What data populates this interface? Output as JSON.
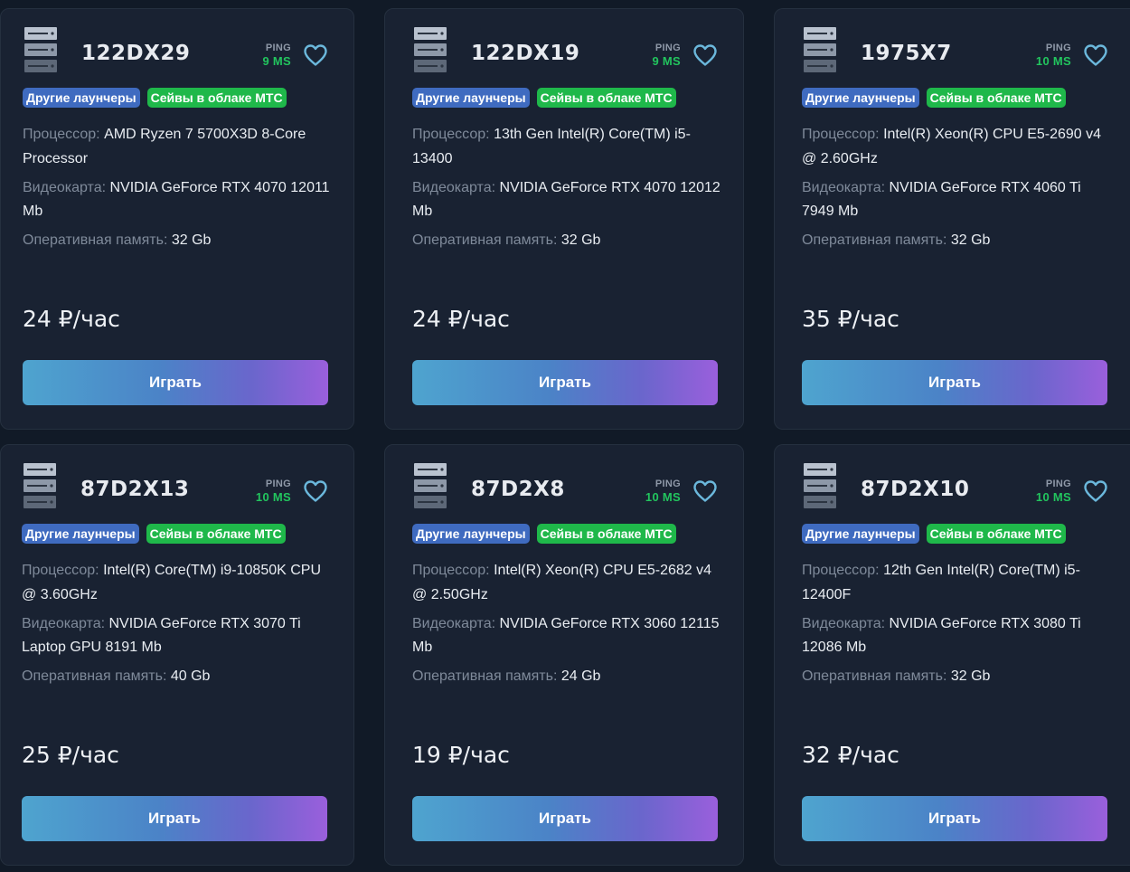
{
  "labels": {
    "ping": "PING",
    "cpu": "Процессор:",
    "gpu": "Видеокарта:",
    "ram": "Оперативная память:",
    "play": "Играть"
  },
  "colors": {
    "background": "#111a27",
    "card": "#192232",
    "ping_green": "#22c55e",
    "tag_blue": "#3f6bc0",
    "tag_green": "#1fb84a",
    "heart": "#6bb8dc"
  },
  "icons": {
    "server": "server-rack-icon",
    "favorite": "heart-icon"
  },
  "servers": [
    {
      "name": "122DX29",
      "ping": "9 MS",
      "tags": [
        "Другие лаунчеры",
        "Сейвы в облаке МТС"
      ],
      "cpu": "AMD Ryzen 7 5700X3D 8-Core Processor",
      "gpu": "NVIDIA GeForce RTX 4070 12011 Mb",
      "ram": "32 Gb",
      "price": "24 ₽/час"
    },
    {
      "name": "122DX19",
      "ping": "9 MS",
      "tags": [
        "Другие лаунчеры",
        "Сейвы в облаке МТС"
      ],
      "cpu": "13th Gen Intel(R) Core(TM) i5-13400",
      "gpu": "NVIDIA GeForce RTX 4070 12012 Mb",
      "ram": "32 Gb",
      "price": "24 ₽/час"
    },
    {
      "name": "1975X7",
      "ping": "10 MS",
      "tags": [
        "Другие лаунчеры",
        "Сейвы в облаке МТС"
      ],
      "cpu": "Intel(R) Xeon(R) CPU E5-2690 v4 @ 2.60GHz",
      "gpu": "NVIDIA GeForce RTX 4060 Ti 7949 Mb",
      "ram": "32 Gb",
      "price": "35 ₽/час"
    },
    {
      "name": "87D2X13",
      "ping": "10 MS",
      "tags": [
        "Другие лаунчеры",
        "Сейвы в облаке МТС"
      ],
      "cpu": "Intel(R) Core(TM) i9-10850K CPU @ 3.60GHz",
      "gpu": "NVIDIA GeForce RTX 3070 Ti Laptop GPU 8191 Mb",
      "ram": "40 Gb",
      "price": "25 ₽/час"
    },
    {
      "name": "87D2X8",
      "ping": "10 MS",
      "tags": [
        "Другие лаунчеры",
        "Сейвы в облаке МТС"
      ],
      "cpu": "Intel(R) Xeon(R) CPU E5-2682 v4 @ 2.50GHz",
      "gpu": "NVIDIA GeForce RTX 3060 12115 Mb",
      "ram": "24 Gb",
      "price": "19 ₽/час"
    },
    {
      "name": "87D2X10",
      "ping": "10 MS",
      "tags": [
        "Другие лаунчеры",
        "Сейвы в облаке МТС"
      ],
      "cpu": "12th Gen Intel(R) Core(TM) i5-12400F",
      "gpu": "NVIDIA GeForce RTX 3080 Ti 12086 Mb",
      "ram": "32 Gb",
      "price": "32 ₽/час"
    }
  ]
}
